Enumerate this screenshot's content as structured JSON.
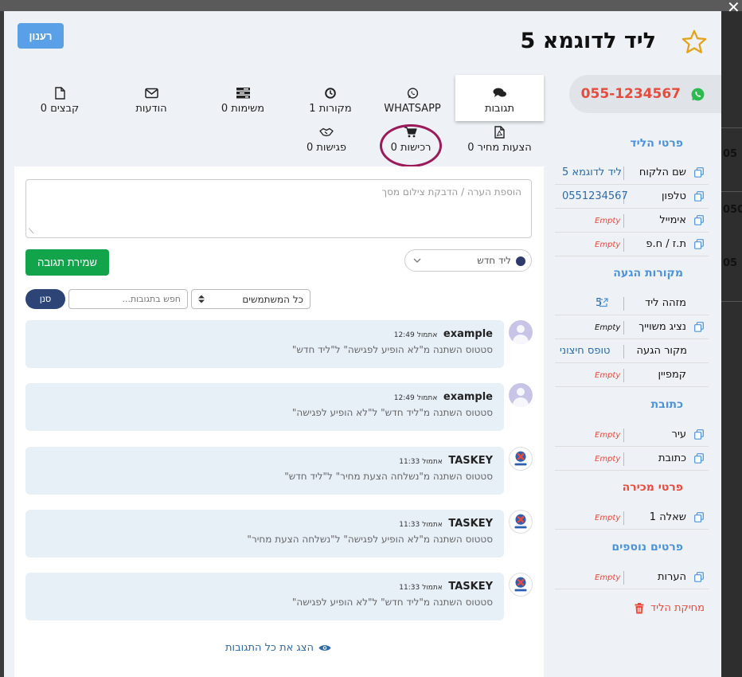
{
  "lead": {
    "title": "ליד לדוגמא 5",
    "phone": "055-1234567"
  },
  "toolbar": {
    "refresh_label": "רענון"
  },
  "tabs": [
    {
      "label": "תגובות",
      "icon": "comments-icon"
    },
    {
      "label": "WHATSAPP",
      "icon": "whatsapp-icon"
    },
    {
      "label": "1 מקורות",
      "icon": "clock-icon"
    },
    {
      "label": "0 משימות",
      "icon": "tasks-icon"
    },
    {
      "label": "הודעות",
      "icon": "envelope-icon"
    },
    {
      "label": "0 קבצים",
      "icon": "file-icon"
    },
    {
      "label": "0 הצעות מחיר",
      "icon": "pdf-icon"
    },
    {
      "label": "0 רכישות",
      "icon": "cart-icon"
    },
    {
      "label": "0 פגישות",
      "icon": "handshake-icon"
    }
  ],
  "comment_form": {
    "placeholder": "הוספת הערה / הדבקת צילום מסך",
    "save_label": "שמירת תגובה",
    "status_value": "ליד חדש"
  },
  "filters": {
    "users_value": "כל המשתמשים",
    "search_placeholder": "חפש בתגובות...",
    "filter_label": "סנן"
  },
  "comments": [
    {
      "author": "example",
      "time": "12:49",
      "prefix": "אתמול",
      "text": "סטטוס השתנה מ\"לא הופיע לפגישה\" ל\"ליד חדש\"",
      "avatar": "user"
    },
    {
      "author": "example",
      "time": "12:49",
      "prefix": "אתמול",
      "text": "סטטוס השתנה מ\"ליד חדש\" ל\"לא הופיע לפגישה\"",
      "avatar": "user"
    },
    {
      "author": "TASKEY",
      "time": "11:33",
      "prefix": "אתמול",
      "text": "סטטוס השתנה מ\"נשלחה הצעת מחיר\" ל\"ליד חדש\"",
      "avatar": "taskey"
    },
    {
      "author": "TASKEY",
      "time": "11:33",
      "prefix": "אתמול",
      "text": "סטטוס השתנה מ\"לא הופיע לפגישה\" ל\"נשלחה הצעת מחיר\"",
      "avatar": "taskey"
    },
    {
      "author": "TASKEY",
      "time": "11:33",
      "prefix": "אתמול",
      "text": "סטטוס השתנה מ\"ליד חדש\" ל\"לא הופיע לפגישה\"",
      "avatar": "taskey"
    }
  ],
  "show_all_label": "הצג את כל התגובות",
  "sidebar": {
    "sections": {
      "lead_details": "פרטי הליד",
      "sources": "מקורות הגעה",
      "address": "כתובת",
      "sale_details": "פרטי מכירה",
      "extra_details": "פרטים נוספים"
    },
    "rows": [
      {
        "label": "שם הלקוח",
        "value": "ליד לדוגמא 5"
      },
      {
        "label": "טלפון",
        "value": "0551234567"
      },
      {
        "label": "אימייל",
        "value": "Empty"
      },
      {
        "label": "ת.ז / ח.פ",
        "value": "Empty"
      },
      {
        "label": "מזהה ליד",
        "value": "5"
      },
      {
        "label": "נציג משוייך",
        "value": "Empty"
      },
      {
        "label": "מקור הגעה",
        "value": "טופס חיצוני"
      },
      {
        "label": "קמפיין",
        "value": "Empty"
      },
      {
        "label": "עיר",
        "value": "Empty"
      },
      {
        "label": "כתובת",
        "value": "Empty"
      },
      {
        "label": "שאלה 1",
        "value": "Empty"
      },
      {
        "label": "הערות",
        "value": "Empty"
      }
    ],
    "delete_label": "מחיקת הליד"
  },
  "background": {
    "numbers": [
      "05",
      "050",
      "05"
    ]
  },
  "colors": {
    "accent": "#4d93d9",
    "danger": "#e84b3c",
    "save": "#12a44b",
    "filter": "#2d4477",
    "highlight": "#9a1a5a"
  }
}
